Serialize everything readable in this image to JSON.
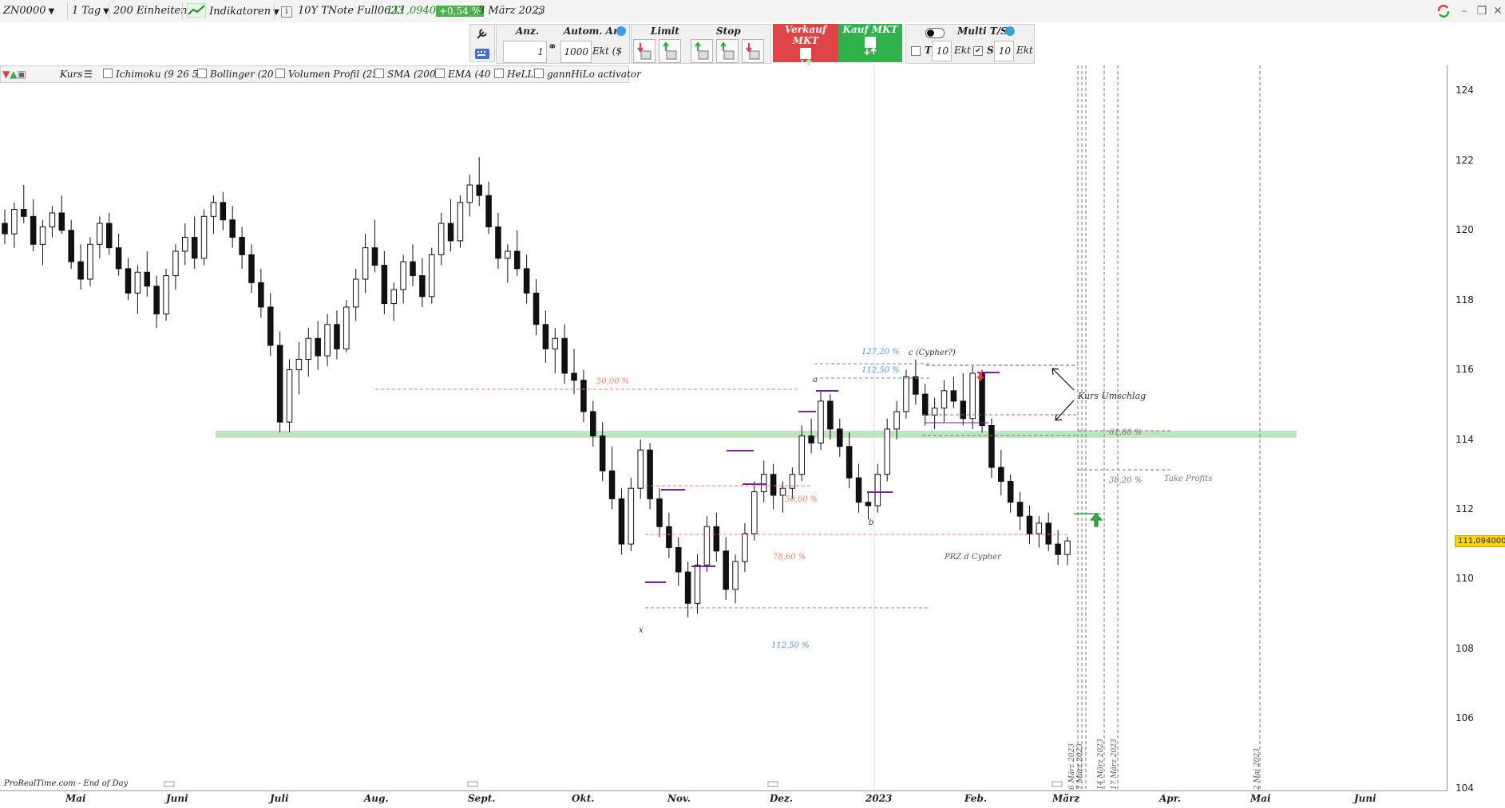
{
  "toolbar": {
    "symbol": "ZN0000",
    "timeframe": "1 Tag",
    "units": "200 Einheiten",
    "indicators_label": "Indikatoren",
    "instrument_name": "10Y TNote Full0623",
    "last_price": "111,094000",
    "change": "+0,54 %",
    "date": "3 März 2023"
  },
  "order_panel": {
    "qty_label": "Anz.",
    "qty_value": "1",
    "auto_qty_label": "Autom. Anz",
    "auto_qty_value": "1000",
    "auto_qty_suffix": "Ekt ($",
    "limit_label": "Limit",
    "stop_label": "Stop",
    "sell_label": "Verkauf MKT",
    "buy_label": "Kauf MKT",
    "multi_label": "Multi T/S",
    "t_label": "T",
    "t_value": "10",
    "t_unit": "Ekt",
    "s_label": "S",
    "s_value": "10",
    "s_unit": "Ekt"
  },
  "indicator_bar": {
    "price_label": "Kurs",
    "items": [
      "Ichimoku (9 26 52,",
      "Bollinger (20 2",
      "Volumen Profil (25",
      "SMA (200",
      "EMA (40",
      "HeLL",
      "gannHiLo activator"
    ]
  },
  "y_axis": [
    "124",
    "122",
    "120",
    "118",
    "116",
    "114",
    "112",
    "110",
    "108",
    "106",
    "104"
  ],
  "x_axis": [
    "Mai",
    "Juni",
    "Juli",
    "Aug.",
    "Sept.",
    "Okt.",
    "Nov.",
    "Dez.",
    "2023",
    "Feb.",
    "März",
    "Apr.",
    "Mai",
    "Juni"
  ],
  "price_label": "111,094000",
  "annotations": {
    "fib_50_top": "50,00 %",
    "fib_50_mid": "50,00 %",
    "fib_78": "78,60 %",
    "fib_112_low": "112,50 %",
    "fib_112_high": "112,50 %",
    "fib_127": "127,20 %",
    "fib_61": "61,80 %",
    "fib_38": "38,20 %",
    "take_profits": "Take Profits",
    "prz": "PRZ d Cypher",
    "c_label": "c (Cypher?)",
    "a_label": "a",
    "b_label": "b",
    "x_label": "x",
    "reversal": "Kurs Umschlag",
    "v_dates": [
      "6 März 2023",
      "7 März 2023",
      "14 März 2023",
      "17 März 2023",
      "2 Mai 2023"
    ],
    "source": "ProRealTime.com - End of Day"
  },
  "colors": {
    "buy": "#2eaf3a",
    "sell": "#e23b3b",
    "support_zone": "#bfe5bf",
    "fib_red": "#f08060",
    "fib_blue": "#5a8fe0",
    "purple": "#7a1fa0"
  },
  "chart_data": {
    "type": "candlestick",
    "instrument": "10Y TNote Full0623",
    "ylim": [
      104,
      124.5
    ],
    "support_zone": [
      114.05,
      114.25
    ],
    "candles": [
      [
        120.2,
        120.6,
        119.6,
        119.9
      ],
      [
        119.9,
        120.8,
        119.5,
        120.6
      ],
      [
        120.6,
        121.3,
        120.2,
        120.4
      ],
      [
        120.4,
        120.9,
        119.4,
        119.6
      ],
      [
        119.6,
        120.3,
        119.0,
        120.1
      ],
      [
        120.1,
        120.7,
        119.8,
        120.5
      ],
      [
        120.5,
        121.0,
        119.9,
        120.0
      ],
      [
        120.0,
        120.3,
        118.9,
        119.1
      ],
      [
        119.1,
        119.6,
        118.3,
        118.6
      ],
      [
        118.6,
        119.8,
        118.4,
        119.6
      ],
      [
        119.6,
        120.4,
        119.2,
        120.2
      ],
      [
        120.2,
        120.5,
        119.3,
        119.5
      ],
      [
        119.5,
        119.9,
        118.7,
        118.9
      ],
      [
        118.9,
        119.2,
        118.0,
        118.2
      ],
      [
        118.2,
        119.0,
        117.6,
        118.8
      ],
      [
        118.8,
        119.4,
        118.1,
        118.4
      ],
      [
        118.4,
        118.7,
        117.2,
        117.6
      ],
      [
        117.6,
        118.9,
        117.4,
        118.7
      ],
      [
        118.7,
        119.6,
        118.3,
        119.4
      ],
      [
        119.4,
        120.2,
        119.0,
        119.8
      ],
      [
        119.8,
        120.4,
        118.9,
        119.2
      ],
      [
        119.2,
        120.6,
        119.0,
        120.4
      ],
      [
        120.4,
        121.0,
        119.9,
        120.8
      ],
      [
        120.8,
        121.1,
        120.0,
        120.3
      ],
      [
        120.3,
        120.7,
        119.5,
        119.8
      ],
      [
        119.8,
        120.1,
        118.9,
        119.3
      ],
      [
        119.3,
        119.6,
        118.2,
        118.5
      ],
      [
        118.5,
        118.9,
        117.5,
        117.8
      ],
      [
        117.8,
        118.2,
        116.4,
        116.7
      ],
      [
        116.7,
        117.1,
        114.2,
        114.5
      ],
      [
        114.5,
        116.3,
        114.2,
        116.0
      ],
      [
        116.0,
        116.8,
        115.3,
        116.3
      ],
      [
        116.3,
        117.2,
        115.8,
        116.9
      ],
      [
        116.9,
        117.4,
        116.0,
        116.4
      ],
      [
        116.4,
        117.6,
        116.1,
        117.3
      ],
      [
        117.3,
        117.7,
        116.3,
        116.6
      ],
      [
        116.6,
        118.0,
        116.5,
        117.8
      ],
      [
        117.8,
        118.9,
        117.4,
        118.6
      ],
      [
        118.6,
        119.9,
        118.2,
        119.5
      ],
      [
        119.5,
        120.3,
        118.8,
        119.0
      ],
      [
        119.0,
        119.4,
        117.6,
        117.9
      ],
      [
        117.9,
        118.5,
        117.4,
        118.3
      ],
      [
        118.3,
        119.3,
        117.9,
        119.1
      ],
      [
        119.1,
        119.6,
        118.4,
        118.7
      ],
      [
        118.7,
        119.2,
        117.8,
        118.1
      ],
      [
        118.1,
        119.5,
        117.9,
        119.3
      ],
      [
        119.3,
        120.5,
        119.0,
        120.2
      ],
      [
        120.2,
        120.9,
        119.4,
        119.7
      ],
      [
        119.7,
        121.0,
        119.5,
        120.8
      ],
      [
        120.8,
        121.6,
        120.4,
        121.3
      ],
      [
        121.3,
        122.1,
        120.7,
        121.0
      ],
      [
        121.0,
        121.4,
        119.9,
        120.1
      ],
      [
        120.1,
        120.5,
        118.9,
        119.2
      ],
      [
        119.2,
        119.6,
        118.5,
        119.4
      ],
      [
        119.4,
        120.0,
        118.7,
        118.9
      ],
      [
        118.9,
        119.3,
        117.9,
        118.2
      ],
      [
        118.2,
        118.6,
        117.0,
        117.3
      ],
      [
        117.3,
        117.7,
        116.2,
        116.6
      ],
      [
        116.6,
        117.2,
        115.9,
        116.9
      ],
      [
        116.9,
        117.3,
        115.6,
        115.9
      ],
      [
        115.9,
        116.6,
        115.3,
        115.7
      ],
      [
        115.7,
        116.0,
        114.5,
        114.8
      ],
      [
        114.8,
        115.1,
        113.8,
        114.1
      ],
      [
        114.1,
        114.5,
        112.8,
        113.1
      ],
      [
        113.1,
        113.8,
        112.0,
        112.3
      ],
      [
        112.3,
        112.6,
        110.7,
        111.0
      ],
      [
        111.0,
        112.9,
        110.8,
        112.6
      ],
      [
        112.6,
        114.0,
        112.3,
        113.7
      ],
      [
        113.7,
        113.9,
        112.0,
        112.3
      ],
      [
        112.3,
        112.6,
        111.2,
        111.5
      ],
      [
        111.5,
        111.9,
        110.6,
        110.9
      ],
      [
        110.9,
        111.2,
        109.8,
        110.2
      ],
      [
        110.2,
        110.5,
        108.9,
        109.3
      ],
      [
        109.3,
        110.7,
        109.0,
        110.4
      ],
      [
        110.4,
        111.8,
        110.2,
        111.5
      ],
      [
        111.5,
        111.9,
        110.5,
        110.8
      ],
      [
        110.8,
        111.2,
        109.4,
        109.7
      ],
      [
        109.7,
        110.7,
        109.3,
        110.5
      ],
      [
        110.5,
        111.6,
        110.2,
        111.3
      ],
      [
        111.3,
        112.8,
        111.1,
        112.5
      ],
      [
        112.5,
        113.4,
        112.2,
        113.0
      ],
      [
        113.0,
        113.3,
        112.0,
        112.4
      ],
      [
        112.4,
        112.8,
        111.9,
        112.6
      ],
      [
        112.6,
        113.2,
        112.3,
        113.0
      ],
      [
        113.0,
        114.4,
        112.8,
        114.1
      ],
      [
        114.1,
        114.6,
        113.6,
        113.9
      ],
      [
        113.9,
        115.4,
        113.7,
        115.1
      ],
      [
        115.1,
        115.3,
        114.0,
        114.3
      ],
      [
        114.3,
        114.6,
        113.5,
        113.8
      ],
      [
        113.8,
        114.2,
        112.6,
        112.9
      ],
      [
        112.9,
        113.3,
        111.9,
        112.2
      ],
      [
        112.2,
        112.5,
        111.7,
        112.1
      ],
      [
        112.1,
        113.3,
        111.9,
        113.0
      ],
      [
        113.0,
        114.6,
        112.8,
        114.3
      ],
      [
        114.3,
        115.1,
        114.0,
        114.8
      ],
      [
        114.8,
        116.0,
        114.6,
        115.8
      ],
      [
        115.8,
        116.3,
        115.0,
        115.3
      ],
      [
        115.3,
        115.6,
        114.4,
        114.7
      ],
      [
        114.7,
        115.2,
        114.3,
        114.9
      ],
      [
        114.9,
        115.7,
        114.5,
        115.4
      ],
      [
        115.4,
        115.8,
        114.9,
        115.1
      ],
      [
        115.1,
        115.9,
        114.4,
        114.6
      ],
      [
        114.6,
        116.1,
        114.3,
        115.9
      ],
      [
        115.9,
        116.0,
        114.2,
        114.4
      ],
      [
        114.4,
        114.6,
        112.9,
        113.2
      ],
      [
        113.2,
        113.7,
        112.4,
        112.8
      ],
      [
        112.8,
        113.0,
        111.9,
        112.2
      ],
      [
        112.2,
        112.5,
        111.4,
        111.8
      ],
      [
        111.8,
        112.1,
        111.0,
        111.3
      ],
      [
        111.3,
        111.8,
        110.9,
        111.6
      ],
      [
        111.6,
        111.9,
        110.8,
        111.0
      ],
      [
        111.0,
        111.4,
        110.4,
        110.7
      ],
      [
        110.7,
        111.2,
        110.4,
        111.09
      ]
    ]
  }
}
